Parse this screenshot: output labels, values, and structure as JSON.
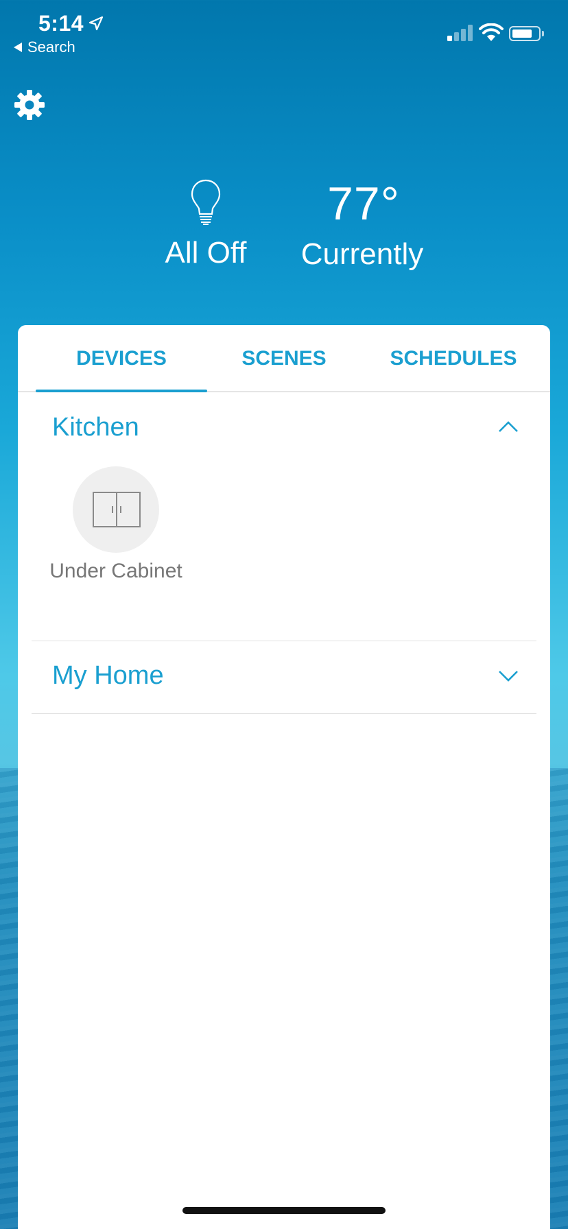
{
  "status_bar": {
    "time": "5:14",
    "back_label": "Search"
  },
  "hero": {
    "lights_label": "All Off",
    "temperature": "77°",
    "temperature_caption": "Currently"
  },
  "tabs": [
    {
      "label": "DEVICES",
      "active": true
    },
    {
      "label": "SCENES",
      "active": false
    },
    {
      "label": "SCHEDULES",
      "active": false
    }
  ],
  "groups": [
    {
      "name": "Kitchen",
      "expanded": true,
      "devices": [
        {
          "label": "Under Cabinet",
          "icon": "cabinet-icon"
        }
      ]
    },
    {
      "name": "My Home",
      "expanded": false,
      "devices": []
    }
  ],
  "colors": {
    "accent": "#1a9fd0",
    "device_label": "#777777",
    "card_background": "#ffffff"
  }
}
